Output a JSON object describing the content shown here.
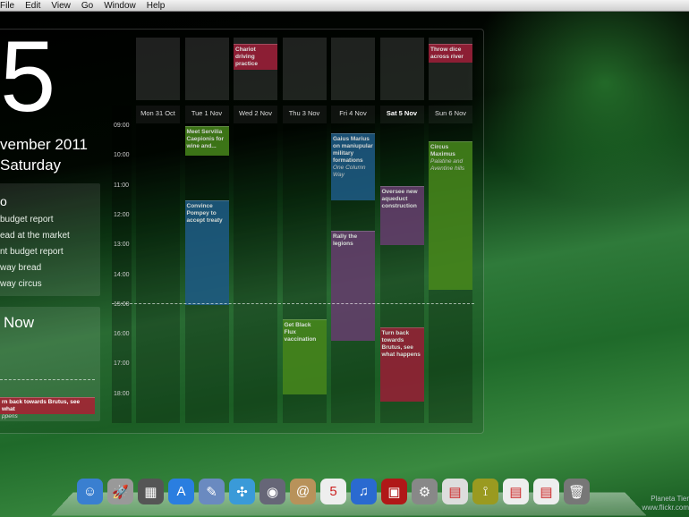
{
  "menu": [
    "File",
    "Edit",
    "View",
    "Go",
    "Window",
    "Help"
  ],
  "date": {
    "day": "5",
    "month_year": "vember 2011",
    "weekday": "Saturday"
  },
  "todo": {
    "heading": "o",
    "items": [
      "budget report",
      "ead at the market",
      "nt budget report",
      "way bread",
      "way circus"
    ]
  },
  "now": {
    "heading": "Now",
    "event_title": "rn back towards Brutus, see what",
    "event_sub": "ppens"
  },
  "times": [
    "09:00",
    "10:00",
    "11:00",
    "12:00",
    "13:00",
    "14:00",
    "15:00",
    "16:00",
    "17:00",
    "18:00"
  ],
  "current_time_hours": 15,
  "colors": {
    "green": "#4a8c1c",
    "blue": "#1f5e8c",
    "purple": "#6a3e72",
    "red": "#a01e38"
  },
  "days": [
    {
      "label": "Mon 31 Oct",
      "today": false,
      "allday": [],
      "events": []
    },
    {
      "label": "Tue 1 Nov",
      "today": false,
      "allday": [],
      "events": [
        {
          "title": "Meet Servilia Caepionis for wine and...",
          "start": 9,
          "end": 10,
          "color": "green"
        },
        {
          "title": "Convince Pompey to accept treaty",
          "start": 11.5,
          "end": 15,
          "color": "blue"
        }
      ]
    },
    {
      "label": "Wed 2 Nov",
      "today": false,
      "allday": [
        {
          "title": "Chariot driving practice",
          "color": "red"
        }
      ],
      "events": []
    },
    {
      "label": "Thu 3 Nov",
      "today": false,
      "allday": [],
      "events": [
        {
          "title": "Get Black Flux vaccination",
          "start": 15.5,
          "end": 18,
          "color": "green"
        }
      ]
    },
    {
      "label": "Fri 4 Nov",
      "today": false,
      "allday": [],
      "events": [
        {
          "title": "Gaius Marius on maniupular military formations",
          "location": "One Column Way",
          "start": 9.25,
          "end": 11.5,
          "color": "blue"
        },
        {
          "title": "Rally the legions",
          "start": 12.5,
          "end": 16.2,
          "color": "purple"
        }
      ]
    },
    {
      "label": "Sat 5 Nov",
      "today": true,
      "allday": [],
      "events": [
        {
          "title": "Oversee new aqueduct construction",
          "start": 11,
          "end": 13,
          "color": "purple"
        },
        {
          "title": "Turn back towards Brutus, see what happens",
          "start": 15.75,
          "end": 18.25,
          "color": "red"
        }
      ]
    },
    {
      "label": "Sun 6 Nov",
      "today": false,
      "allday": [
        {
          "title": "Throw dice across river",
          "color": "red"
        }
      ],
      "events": [
        {
          "title": "Circus Maximus",
          "location": "Palatine and Aventine hills",
          "start": 9.5,
          "end": 14.5,
          "color": "green"
        }
      ]
    }
  ],
  "dock": [
    {
      "name": "finder",
      "glyph": "☺",
      "bg": "#3a7fd0"
    },
    {
      "name": "launchpad",
      "glyph": "🚀",
      "bg": "#999"
    },
    {
      "name": "mission-control",
      "glyph": "▦",
      "bg": "#555"
    },
    {
      "name": "app-store",
      "glyph": "A",
      "bg": "#2a7ee0"
    },
    {
      "name": "preview",
      "glyph": "✎",
      "bg": "#6a8ac0"
    },
    {
      "name": "safari",
      "glyph": "✣",
      "bg": "#3a9ad8"
    },
    {
      "name": "facetime",
      "glyph": "◉",
      "bg": "#667"
    },
    {
      "name": "address-book",
      "glyph": "@",
      "bg": "#b8925a"
    },
    {
      "name": "ical",
      "glyph": "5",
      "bg": "#eee"
    },
    {
      "name": "itunes",
      "glyph": "♫",
      "bg": "#2a6ad0"
    },
    {
      "name": "photo-booth",
      "glyph": "▣",
      "bg": "#b01818"
    },
    {
      "name": "system-preferences",
      "glyph": "⚙",
      "bg": "#888"
    },
    {
      "name": "calendar-app",
      "glyph": "▤",
      "bg": "#ddd"
    },
    {
      "name": "utility",
      "glyph": "⟟",
      "bg": "#9a9a20"
    },
    {
      "name": "document",
      "glyph": "▤",
      "bg": "#eee"
    },
    {
      "name": "document-2",
      "glyph": "▤",
      "bg": "#eee"
    },
    {
      "name": "trash",
      "glyph": "🗑",
      "bg": "#777"
    }
  ],
  "watermark": {
    "line1": "Planeta Tier",
    "line2": "www.flickr.com"
  }
}
